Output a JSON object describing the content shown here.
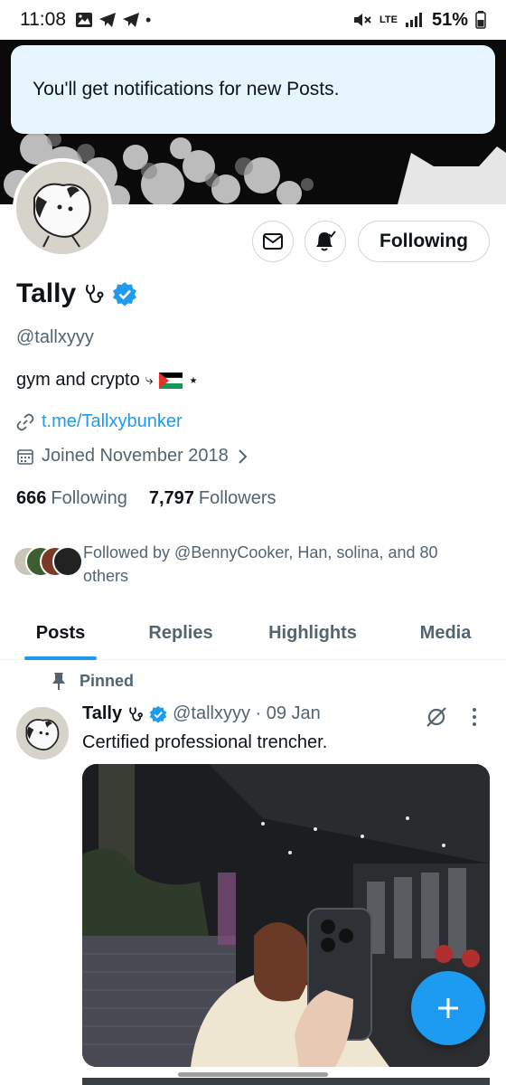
{
  "status_bar": {
    "time": "11:08",
    "signal_label": "LTE",
    "battery": "51%"
  },
  "toast": {
    "message": "You'll get notifications for new Posts."
  },
  "profile": {
    "name": "Tally",
    "handle": "@tallxyyy",
    "bio_text": "gym and crypto",
    "bio_extra": "⤷",
    "bio_star": "⋆",
    "link": "t.me/Tallxybunker",
    "joined": "Joined November 2018",
    "following_count": "666",
    "following_label": "Following",
    "followers_count": "7,797",
    "followers_label": "Followers",
    "followed_by": "Followed by @BennyCooker, Han, solina, and 80 others"
  },
  "actions": {
    "follow_label": "Following"
  },
  "tabs": [
    {
      "label": "Posts"
    },
    {
      "label": "Replies"
    },
    {
      "label": "Highlights"
    },
    {
      "label": "Media"
    }
  ],
  "post": {
    "pinned_label": "Pinned",
    "author": "Tally",
    "meta": "@tallxyyy · 09 Jan",
    "text": "Certified professional trencher."
  },
  "colors": {
    "accent": "#1d9bf0",
    "text_primary": "#0f1419",
    "text_secondary": "#536471",
    "toast_bg": "#e7f5fe"
  }
}
